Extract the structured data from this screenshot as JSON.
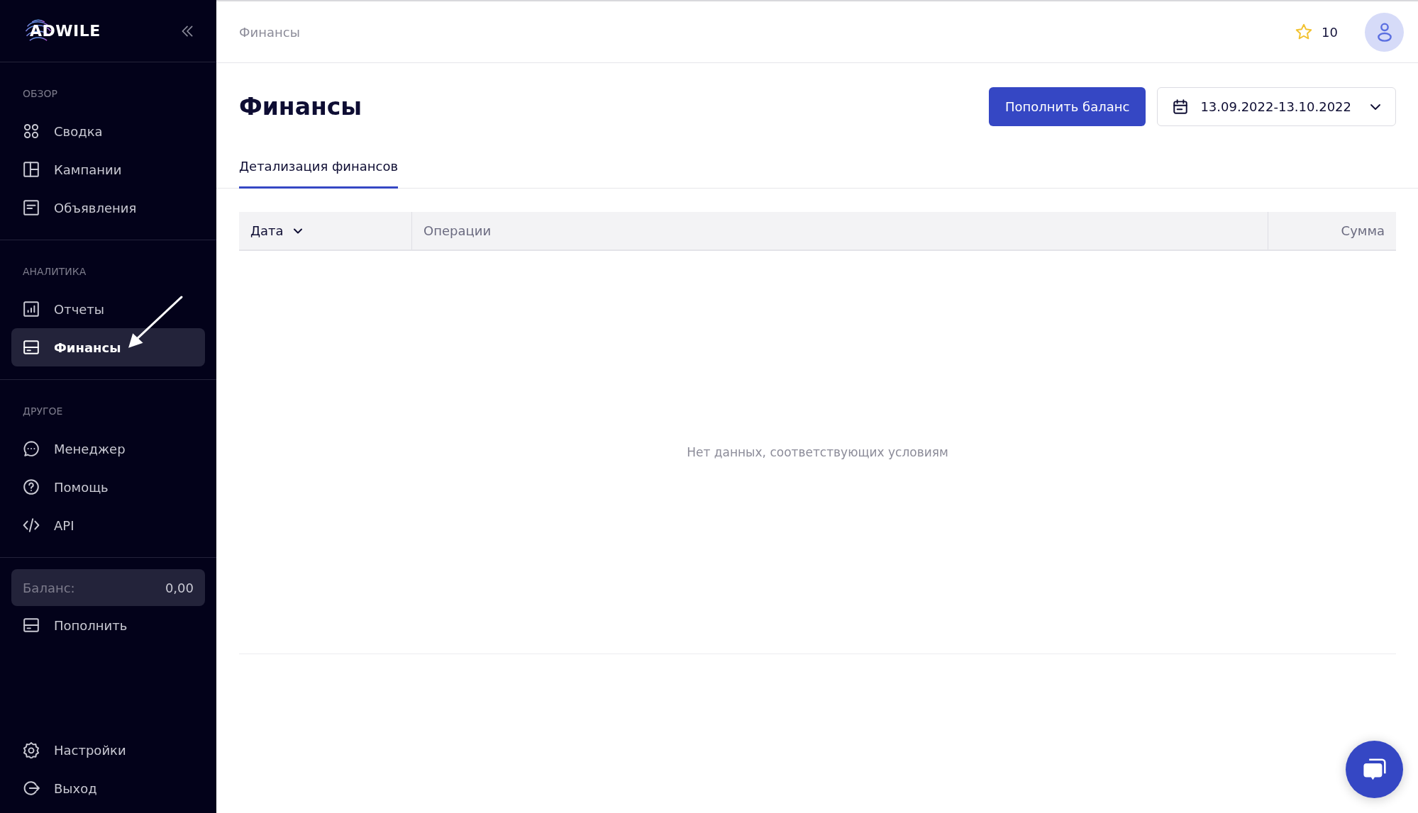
{
  "sidebar": {
    "logo": "ADWILE",
    "groups": [
      {
        "label": "ОБЗОР",
        "items": [
          {
            "label": "Сводка",
            "selected": false
          },
          {
            "label": "Кампании",
            "selected": false
          },
          {
            "label": "Объявления",
            "selected": false
          }
        ]
      },
      {
        "label": "АНАЛИТИКА",
        "items": [
          {
            "label": "Отчеты",
            "selected": false
          },
          {
            "label": "Финансы",
            "selected": true
          }
        ]
      },
      {
        "label": "ДРУГОЕ",
        "items": [
          {
            "label": "Менеджер",
            "selected": false
          },
          {
            "label": "Помощь",
            "selected": false
          },
          {
            "label": "API",
            "selected": false
          }
        ]
      }
    ],
    "balance": {
      "label": "Баланс:",
      "value": "0,00"
    },
    "top_up": "Пополнить",
    "footer_items": [
      {
        "label": "Настройки",
        "selected": false
      },
      {
        "label": "Выход",
        "selected": false
      }
    ]
  },
  "header": {
    "breadcrumb": "Финансы",
    "stars_count": "10"
  },
  "page": {
    "title": "Финансы",
    "top_up_button": "Пополнить баланс",
    "date_range": "13.09.2022-13.10.2022",
    "tabs": [
      {
        "label": "Детализация финансов",
        "selected": true
      }
    ],
    "table": {
      "columns": [
        {
          "label": "Дата",
          "sorted": true
        },
        {
          "label": "Операции",
          "sorted": false
        },
        {
          "label": "Сумма",
          "sorted": false
        }
      ],
      "empty_text": "Нет данных, соответствующих условиям"
    }
  }
}
